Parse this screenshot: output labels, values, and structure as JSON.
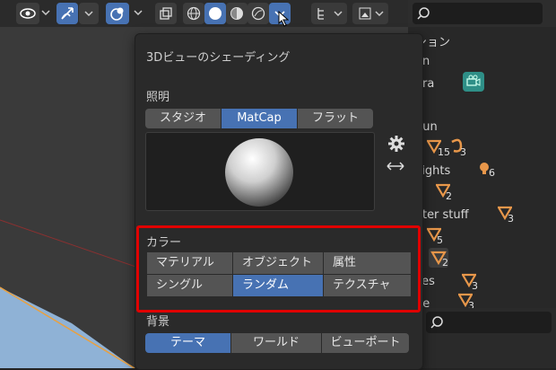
{
  "shading_popover": {
    "title": "3Dビューのシェーディング",
    "lighting_label": "照明",
    "lighting_options": [
      "スタジオ",
      "MatCap",
      "フラット"
    ],
    "lighting_selected": "MatCap",
    "color_label": "カラー",
    "color_options": [
      "マテリアル",
      "オブジェクト",
      "属性",
      "シングル",
      "ランダム",
      "テクスチャ"
    ],
    "color_selected": "ランダム",
    "background_label": "背景",
    "background_options": [
      "テーマ",
      "ワールド",
      "ビューポート"
    ],
    "background_selected": "テーマ"
  },
  "outliner": {
    "rows": [
      "ション",
      "on",
      "era",
      "Sun",
      "Lights",
      "ater stuff",
      "kes",
      "pe"
    ],
    "badges": [
      "15",
      "3",
      "6",
      "2",
      "3",
      "5",
      "2",
      "3",
      "3"
    ]
  },
  "colors": {
    "accent": "#4772b3",
    "highlight": "#e00000"
  },
  "icons": [
    "eye-icon",
    "cursor-icon",
    "gizmo-icon",
    "overlay-icon",
    "xray-icon",
    "wireframe-icon",
    "solid-icon",
    "material-preview-icon",
    "rendered-icon",
    "gear-icon",
    "flip-arrow-icon",
    "search-icon",
    "camera-icon",
    "light-icon"
  ]
}
